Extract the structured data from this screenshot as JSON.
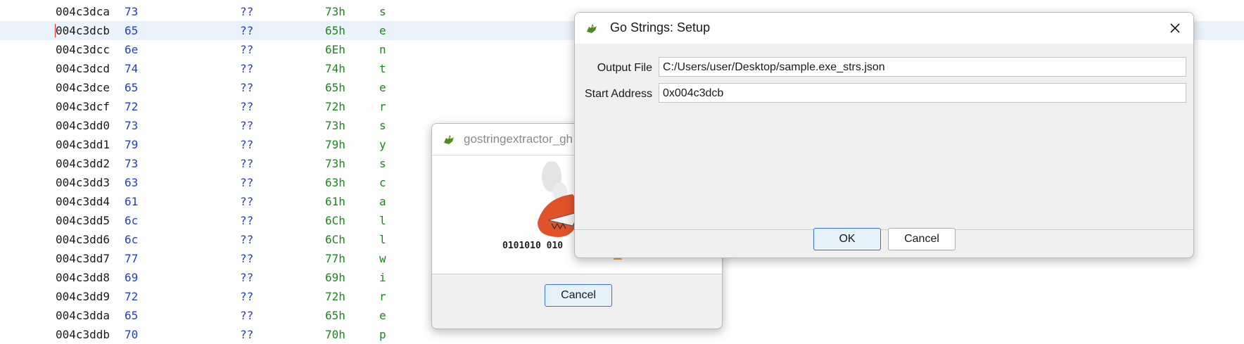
{
  "listing": {
    "rows": [
      {
        "addr": "004c3dca",
        "byte": "73",
        "q": "??",
        "hex": "73h",
        "chr": "s"
      },
      {
        "addr": "004c3dcb",
        "byte": "65",
        "q": "??",
        "hex": "65h",
        "chr": "e"
      },
      {
        "addr": "004c3dcc",
        "byte": "6e",
        "q": "??",
        "hex": "6Eh",
        "chr": "n"
      },
      {
        "addr": "004c3dcd",
        "byte": "74",
        "q": "??",
        "hex": "74h",
        "chr": "t"
      },
      {
        "addr": "004c3dce",
        "byte": "65",
        "q": "??",
        "hex": "65h",
        "chr": "e"
      },
      {
        "addr": "004c3dcf",
        "byte": "72",
        "q": "??",
        "hex": "72h",
        "chr": "r"
      },
      {
        "addr": "004c3dd0",
        "byte": "73",
        "q": "??",
        "hex": "73h",
        "chr": "s"
      },
      {
        "addr": "004c3dd1",
        "byte": "79",
        "q": "??",
        "hex": "79h",
        "chr": "y"
      },
      {
        "addr": "004c3dd2",
        "byte": "73",
        "q": "??",
        "hex": "73h",
        "chr": "s"
      },
      {
        "addr": "004c3dd3",
        "byte": "63",
        "q": "??",
        "hex": "63h",
        "chr": "c"
      },
      {
        "addr": "004c3dd4",
        "byte": "61",
        "q": "??",
        "hex": "61h",
        "chr": "a"
      },
      {
        "addr": "004c3dd5",
        "byte": "6c",
        "q": "??",
        "hex": "6Ch",
        "chr": "l"
      },
      {
        "addr": "004c3dd6",
        "byte": "6c",
        "q": "??",
        "hex": "6Ch",
        "chr": "l"
      },
      {
        "addr": "004c3dd7",
        "byte": "77",
        "q": "??",
        "hex": "77h",
        "chr": "w"
      },
      {
        "addr": "004c3dd8",
        "byte": "69",
        "q": "??",
        "hex": "69h",
        "chr": "i"
      },
      {
        "addr": "004c3dd9",
        "byte": "72",
        "q": "??",
        "hex": "72h",
        "chr": "r"
      },
      {
        "addr": "004c3dda",
        "byte": "65",
        "q": "??",
        "hex": "65h",
        "chr": "e"
      },
      {
        "addr": "004c3ddb",
        "byte": "70",
        "q": "??",
        "hex": "70h",
        "chr": "p"
      }
    ],
    "selected_row": 1
  },
  "progress_dialog": {
    "title": "gostringextractor_gh",
    "splash_text": "0101010 010",
    "cancel_label": "Cancel"
  },
  "setup_dialog": {
    "title": "Go Strings: Setup",
    "output_file_label": "Output File",
    "output_file_value": "C:/Users/user/Desktop/sample.exe_strs.json",
    "start_address_label": "Start Address",
    "start_address_value": "0x004c3dcb",
    "ok_label": "OK",
    "cancel_label": "Cancel"
  },
  "colors": {
    "selection": "#eaf2fb",
    "address": "#1a1a1a",
    "bytes": "#2040c8",
    "ascii": "#1a8a1a",
    "primary_border": "#3574c6"
  }
}
